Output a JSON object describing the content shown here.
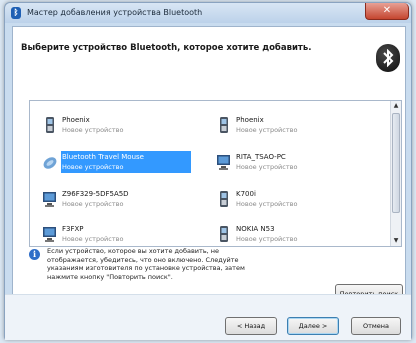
{
  "window": {
    "title": "Мастер добавления устройства Bluetooth",
    "close_glyph": "✕",
    "title_icon": "bluetooth-icon"
  },
  "header": {
    "heading": "Выберите устройство Bluetooth, которое хотите добавить.",
    "logo_icon": "bluetooth-logo-icon"
  },
  "devices": [
    {
      "name": "Phoenix",
      "type": "Новое устройство",
      "icon": "phone-icon",
      "selected": false
    },
    {
      "name": "Phoenix",
      "type": "Новое устройство",
      "icon": "phone-icon",
      "selected": false
    },
    {
      "name": "Bluetooth Travel Mouse",
      "type": "Новое устройство",
      "icon": "mouse-icon",
      "selected": true
    },
    {
      "name": "RITA_TSAO-PC",
      "type": "Новое устройство",
      "icon": "computer-icon",
      "selected": false
    },
    {
      "name": "Z96F329-5DF5A5D",
      "type": "Новое устройство",
      "icon": "computer-icon",
      "selected": false
    },
    {
      "name": "K700i",
      "type": "Новое устройство",
      "icon": "phone-icon",
      "selected": false
    },
    {
      "name": "F3FXP",
      "type": "Новое устройство",
      "icon": "computer-icon",
      "selected": false
    },
    {
      "name": "NOKIA N53",
      "type": "Новое устройство",
      "icon": "phone-icon",
      "selected": false
    }
  ],
  "info": {
    "icon": "info-icon",
    "text": "Если устройство, которое вы хотите добавить, не отображается, убедитесь, что оно включено. Следуйте указаниям изготовителя по установке устройства, затем нажмите кнопку \"Повторить поиск\"."
  },
  "buttons": {
    "repeat": "Повторить поиск",
    "back": "< Назад",
    "next": "Далее >",
    "cancel": "Отмена"
  },
  "scrollbar": {
    "up": "▲",
    "down": "▼"
  }
}
